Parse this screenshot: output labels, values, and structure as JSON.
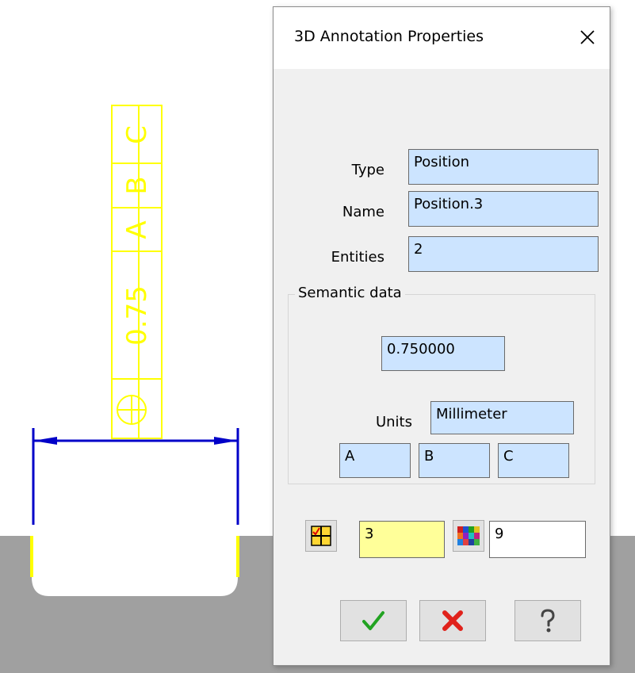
{
  "viewport": {
    "frame_cells": [
      "⊕",
      "0.75",
      "A",
      "B",
      "C"
    ],
    "colors": {
      "annotation": "#ffff00",
      "dimension": "#0000c8",
      "ground": "#a0a0a0"
    }
  },
  "dialog": {
    "title": "3D Annotation Properties",
    "close_icon": "close-icon",
    "fields": {
      "type": {
        "label": "Type",
        "value": "Position"
      },
      "name": {
        "label": "Name",
        "value": "Position.3"
      },
      "entities": {
        "label": "Entities",
        "value": "2"
      }
    },
    "semantic": {
      "legend": "Semantic data",
      "tolerance": "0.750000",
      "units_label": "Units",
      "units_value": "Millimeter",
      "datums": [
        "A",
        "B",
        "C"
      ]
    },
    "controls": {
      "line_weight_icon": "line-weight-icon",
      "line_weight_value": "3",
      "color_palette_icon": "color-palette-icon",
      "color_value": "9"
    },
    "buttons": {
      "ok_icon": "checkmark-icon",
      "cancel_icon": "red-x-icon",
      "help_icon": "question-mark-icon"
    },
    "colors": {
      "field_bg": "#cce4ff",
      "highlight_field_bg": "#ffff99",
      "ok": "#22a322",
      "cancel": "#e0221b"
    }
  }
}
